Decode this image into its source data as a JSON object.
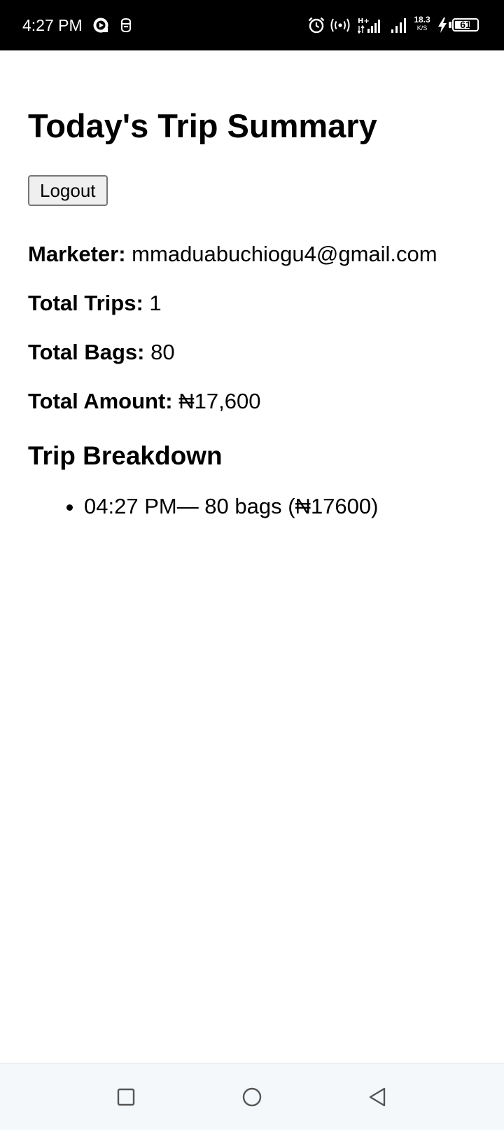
{
  "status_bar": {
    "time": "4:27 PM",
    "net_speed_value": "18.3",
    "net_speed_unit": "K/S",
    "battery_level": "61",
    "icons": [
      "screen-record-icon",
      "notification-icon",
      "alarm-icon",
      "hotspot-icon",
      "hplus-signal-icon",
      "signal-icon",
      "charging-icon",
      "battery-icon"
    ]
  },
  "page": {
    "title": "Today's Trip Summary",
    "logout_label": "Logout"
  },
  "summary": {
    "marketer_label": "Marketer:",
    "marketer_value": " mmaduabuchiogu4@gmail.com",
    "trips_label": "Total Trips:",
    "trips_value": " 1",
    "bags_label": "Total Bags:",
    "bags_value": " 80",
    "amount_label": "Total Amount:",
    "amount_value": " ₦17,600"
  },
  "breakdown": {
    "title": "Trip Breakdown",
    "items": [
      "04:27 PM— 80 bags (₦17600)"
    ]
  },
  "nav_bar": {
    "buttons": [
      "recents-square-icon",
      "home-circle-icon",
      "back-triangle-icon"
    ]
  }
}
